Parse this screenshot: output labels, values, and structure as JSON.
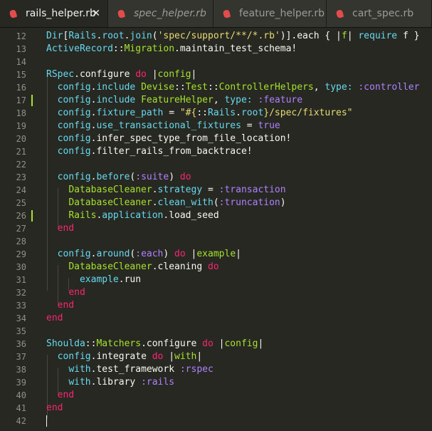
{
  "tabs": [
    {
      "label": "rails_helper.rb",
      "active": true,
      "italic": false,
      "close": "✕"
    },
    {
      "label": "spec_helper.rb",
      "active": false,
      "italic": true
    },
    {
      "label": "feature_helper.rb",
      "active": false,
      "italic": false
    },
    {
      "label": "cart_spec.rb",
      "active": false,
      "italic": false
    }
  ],
  "colors": {
    "background": "#272822",
    "keyword": "#f92672",
    "constant": "#66d9ef",
    "function": "#a6e22e",
    "string": "#e6db74",
    "symbol": "#ae81ff",
    "gutter_modified": "#a6e22e",
    "file_icon": "#e24c4c"
  },
  "lines": [
    {
      "n": "12",
      "tokens": [
        [
          "c",
          "Dir"
        ],
        [
          "pl",
          "["
        ],
        [
          "c",
          "Rails"
        ],
        [
          "pl",
          "."
        ],
        [
          "c",
          "root"
        ],
        [
          "pl",
          "."
        ],
        [
          "c",
          "join"
        ],
        [
          "pl",
          "("
        ],
        [
          "s",
          "'spec/support/**/*.rb'"
        ],
        [
          "pl",
          ")]."
        ],
        [
          "pl",
          "each { |"
        ],
        [
          "f",
          "f"
        ],
        [
          "pl",
          "| "
        ],
        [
          "c",
          "require"
        ],
        [
          "pl",
          " f }"
        ]
      ]
    },
    {
      "n": "13",
      "tokens": [
        [
          "c",
          "ActiveRecord"
        ],
        [
          "pl",
          "::"
        ],
        [
          "f",
          "Migration"
        ],
        [
          "pl",
          ".maintain_test_schema!"
        ]
      ]
    },
    {
      "n": "14",
      "tokens": []
    },
    {
      "n": "15",
      "tokens": [
        [
          "c",
          "RSpec"
        ],
        [
          "pl",
          ".configure "
        ],
        [
          "k",
          "do"
        ],
        [
          "pl",
          " |"
        ],
        [
          "f",
          "config"
        ],
        [
          "pl",
          "|"
        ]
      ]
    },
    {
      "n": "16",
      "tokens": [
        [
          "pl",
          "  "
        ],
        [
          "c",
          "config"
        ],
        [
          "pl",
          "."
        ],
        [
          "c",
          "include"
        ],
        [
          "pl",
          " "
        ],
        [
          "f",
          "Devise"
        ],
        [
          "pl",
          "::"
        ],
        [
          "f",
          "Test"
        ],
        [
          "pl",
          "::"
        ],
        [
          "f",
          "ControllerHelpers"
        ],
        [
          "pl",
          ", "
        ],
        [
          "c",
          "type:"
        ],
        [
          "pl",
          " "
        ],
        [
          "sy",
          ":controller"
        ]
      ]
    },
    {
      "n": "17",
      "modified": true,
      "tokens": [
        [
          "pl",
          "  "
        ],
        [
          "c",
          "config"
        ],
        [
          "pl",
          "."
        ],
        [
          "c",
          "include"
        ],
        [
          "pl",
          " "
        ],
        [
          "f",
          "FeatureHelper"
        ],
        [
          "pl",
          ", "
        ],
        [
          "c",
          "type:"
        ],
        [
          "pl",
          " "
        ],
        [
          "sy",
          ":feature"
        ]
      ]
    },
    {
      "n": "18",
      "tokens": [
        [
          "pl",
          "  "
        ],
        [
          "c",
          "config"
        ],
        [
          "pl",
          "."
        ],
        [
          "c",
          "fixture_path"
        ],
        [
          "pl",
          " = "
        ],
        [
          "s",
          "\"#{"
        ],
        [
          "pl",
          "::"
        ],
        [
          "c",
          "Rails"
        ],
        [
          "pl",
          "."
        ],
        [
          "c",
          "root"
        ],
        [
          "s",
          "}/spec/fixtures\""
        ]
      ]
    },
    {
      "n": "19",
      "tokens": [
        [
          "pl",
          "  "
        ],
        [
          "c",
          "config"
        ],
        [
          "pl",
          "."
        ],
        [
          "c",
          "use_transactional_fixtures"
        ],
        [
          "pl",
          " = "
        ],
        [
          "sy",
          "true"
        ]
      ]
    },
    {
      "n": "20",
      "tokens": [
        [
          "pl",
          "  "
        ],
        [
          "c",
          "config"
        ],
        [
          "pl",
          ".infer_spec_type_from_file_location!"
        ]
      ]
    },
    {
      "n": "21",
      "tokens": [
        [
          "pl",
          "  "
        ],
        [
          "c",
          "config"
        ],
        [
          "pl",
          ".filter_rails_from_backtrace!"
        ]
      ]
    },
    {
      "n": "22",
      "tokens": []
    },
    {
      "n": "23",
      "tokens": [
        [
          "pl",
          "  "
        ],
        [
          "c",
          "config"
        ],
        [
          "pl",
          "."
        ],
        [
          "c",
          "before"
        ],
        [
          "pl",
          "("
        ],
        [
          "sy",
          ":suite"
        ],
        [
          "pl",
          ") "
        ],
        [
          "k",
          "do"
        ]
      ]
    },
    {
      "n": "24",
      "tokens": [
        [
          "pl",
          "    "
        ],
        [
          "f",
          "DatabaseCleaner"
        ],
        [
          "pl",
          "."
        ],
        [
          "c",
          "strategy"
        ],
        [
          "pl",
          " = "
        ],
        [
          "sy",
          ":transaction"
        ]
      ]
    },
    {
      "n": "25",
      "tokens": [
        [
          "pl",
          "    "
        ],
        [
          "f",
          "DatabaseCleaner"
        ],
        [
          "pl",
          "."
        ],
        [
          "c",
          "clean_with"
        ],
        [
          "pl",
          "("
        ],
        [
          "sy",
          ":truncation"
        ],
        [
          "pl",
          ")"
        ]
      ]
    },
    {
      "n": "26",
      "modified": true,
      "tokens": [
        [
          "pl",
          "    "
        ],
        [
          "f",
          "Rails"
        ],
        [
          "pl",
          "."
        ],
        [
          "c",
          "application"
        ],
        [
          "pl",
          ".load_seed"
        ]
      ]
    },
    {
      "n": "27",
      "tokens": [
        [
          "pl",
          "  "
        ],
        [
          "k",
          "end"
        ]
      ]
    },
    {
      "n": "28",
      "tokens": []
    },
    {
      "n": "29",
      "tokens": [
        [
          "pl",
          "  "
        ],
        [
          "c",
          "config"
        ],
        [
          "pl",
          "."
        ],
        [
          "c",
          "around"
        ],
        [
          "pl",
          "("
        ],
        [
          "sy",
          ":each"
        ],
        [
          "pl",
          ") "
        ],
        [
          "k",
          "do"
        ],
        [
          "pl",
          " |"
        ],
        [
          "f",
          "example"
        ],
        [
          "pl",
          "|"
        ]
      ]
    },
    {
      "n": "30",
      "tokens": [
        [
          "pl",
          "    "
        ],
        [
          "f",
          "DatabaseCleaner"
        ],
        [
          "pl",
          ".cleaning "
        ],
        [
          "k",
          "do"
        ]
      ]
    },
    {
      "n": "31",
      "tokens": [
        [
          "pl",
          "      "
        ],
        [
          "c",
          "example"
        ],
        [
          "pl",
          ".run"
        ]
      ]
    },
    {
      "n": "32",
      "tokens": [
        [
          "pl",
          "    "
        ],
        [
          "k",
          "end"
        ]
      ]
    },
    {
      "n": "33",
      "tokens": [
        [
          "pl",
          "  "
        ],
        [
          "k",
          "end"
        ]
      ]
    },
    {
      "n": "34",
      "tokens": [
        [
          "k",
          "end"
        ]
      ]
    },
    {
      "n": "35",
      "tokens": []
    },
    {
      "n": "36",
      "tokens": [
        [
          "c",
          "Shoulda"
        ],
        [
          "pl",
          "::"
        ],
        [
          "f",
          "Matchers"
        ],
        [
          "pl",
          ".configure "
        ],
        [
          "k",
          "do"
        ],
        [
          "pl",
          " |"
        ],
        [
          "f",
          "config"
        ],
        [
          "pl",
          "|"
        ]
      ]
    },
    {
      "n": "37",
      "tokens": [
        [
          "pl",
          "  "
        ],
        [
          "c",
          "config"
        ],
        [
          "pl",
          ".integrate "
        ],
        [
          "k",
          "do"
        ],
        [
          "pl",
          " |"
        ],
        [
          "f",
          "with"
        ],
        [
          "pl",
          "|"
        ]
      ]
    },
    {
      "n": "38",
      "tokens": [
        [
          "pl",
          "    "
        ],
        [
          "c",
          "with"
        ],
        [
          "pl",
          ".test_framework "
        ],
        [
          "sy",
          ":rspec"
        ]
      ]
    },
    {
      "n": "39",
      "tokens": [
        [
          "pl",
          "    "
        ],
        [
          "c",
          "with"
        ],
        [
          "pl",
          ".library "
        ],
        [
          "sy",
          ":rails"
        ]
      ]
    },
    {
      "n": "40",
      "tokens": [
        [
          "pl",
          "  "
        ],
        [
          "k",
          "end"
        ]
      ]
    },
    {
      "n": "41",
      "tokens": [
        [
          "k",
          "end"
        ]
      ]
    },
    {
      "n": "42",
      "tokens": [],
      "cursor": true
    }
  ]
}
